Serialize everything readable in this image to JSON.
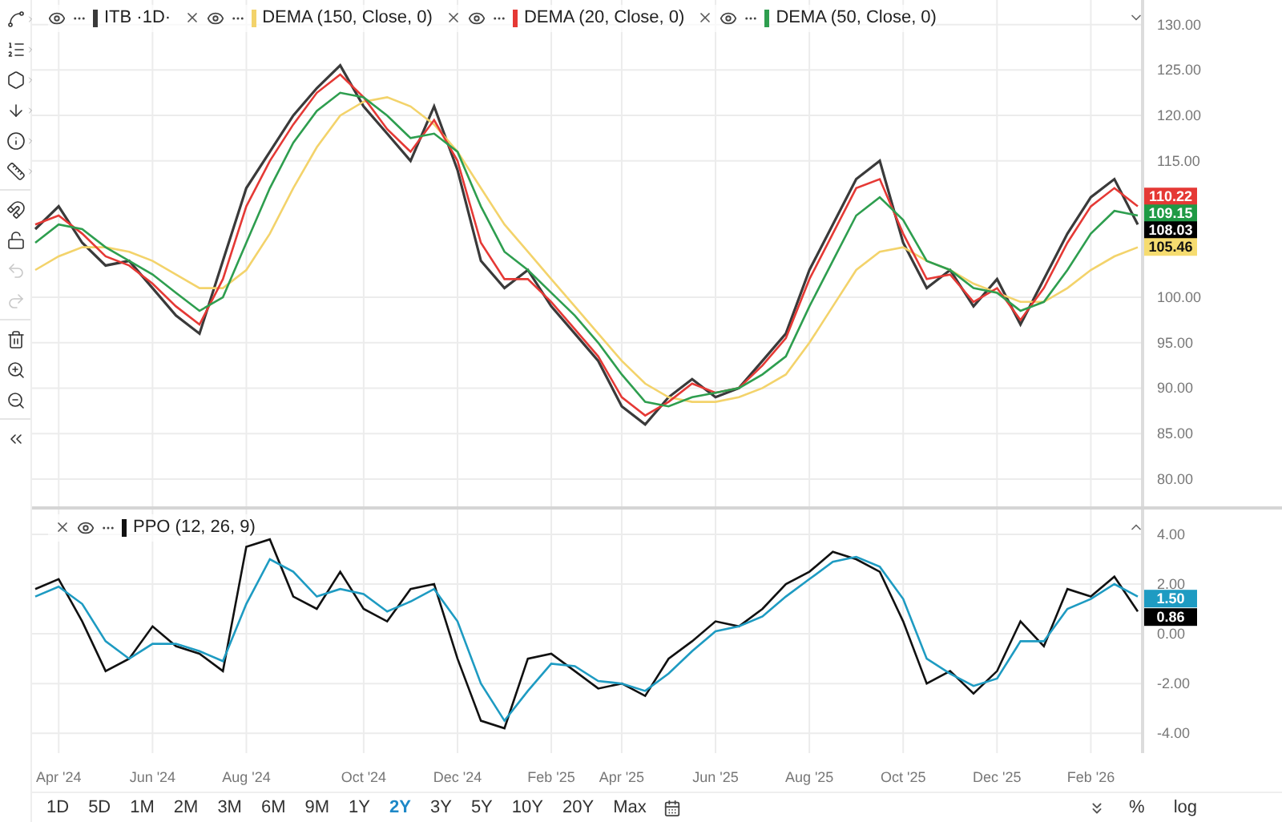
{
  "toolbar": [
    {
      "kind": "trendline",
      "submenu": true,
      "disabled": false
    },
    {
      "kind": "list",
      "submenu": true,
      "disabled": false
    },
    {
      "kind": "shape",
      "submenu": true,
      "disabled": false
    },
    {
      "kind": "arrow",
      "submenu": true,
      "disabled": false
    },
    {
      "kind": "info",
      "submenu": true,
      "disabled": false
    },
    {
      "kind": "measure",
      "submenu": true,
      "disabled": false
    },
    {
      "kind": "magnet",
      "submenu": false,
      "disabled": false
    },
    {
      "kind": "lock",
      "submenu": false,
      "disabled": false
    },
    {
      "kind": "undo",
      "submenu": false,
      "disabled": true
    },
    {
      "kind": "redo",
      "submenu": false,
      "disabled": true
    },
    {
      "kind": "trash",
      "submenu": false,
      "disabled": false
    },
    {
      "kind": "zoom_in",
      "submenu": false,
      "disabled": false
    },
    {
      "kind": "zoom_out",
      "submenu": false,
      "disabled": false
    },
    {
      "kind": "collapse",
      "submenu": false,
      "disabled": false
    }
  ],
  "price_pane": {
    "legend": [
      {
        "closable": false
      },
      {
        "closable": true
      },
      {
        "closable": true
      },
      {
        "closable": true
      }
    ],
    "last_values": [
      {
        "value": "110.22",
        "color": "#e53935"
      },
      {
        "value": "109.15",
        "color": "#1f9a45"
      },
      {
        "value": "108.03",
        "color": "#000000"
      },
      {
        "value": "105.46",
        "color": "#f6dc70"
      }
    ],
    "chart_data": {
      "type": "line",
      "grid": true,
      "ylim": [
        77,
        132.7
      ],
      "categories": [
        null,
        null,
        null,
        null,
        null,
        null,
        null,
        null,
        null,
        null,
        null,
        null,
        null,
        null,
        null,
        null,
        null,
        null,
        null,
        null,
        null,
        null,
        null,
        null,
        null,
        null,
        null,
        null,
        null,
        null,
        null,
        null,
        null,
        null,
        null,
        null,
        null,
        null,
        null,
        null,
        null,
        null,
        null,
        null,
        null,
        null,
        null,
        null
      ],
      "yticks": [
        {
          "value": 130,
          "label": "130.00"
        },
        {
          "value": 125,
          "label": "125.00"
        },
        {
          "value": 120,
          "label": "120.00"
        },
        {
          "value": 115,
          "label": "115.00"
        },
        {
          "value": 100,
          "label": "100.00"
        },
        {
          "value": 95,
          "label": "95.00"
        },
        {
          "value": 90,
          "label": "90.00"
        },
        {
          "value": 85,
          "label": "85.00"
        },
        {
          "value": 80,
          "label": "80.00"
        }
      ],
      "series": [
        {
          "name": "ITB ·1D·",
          "color": "#3a3a3a",
          "values": [
            107.5,
            110,
            106,
            103.5,
            104,
            101,
            98,
            96,
            104,
            112,
            116,
            120,
            123,
            125.5,
            121,
            118,
            115,
            121,
            114,
            104,
            101,
            103,
            99,
            96,
            93,
            88,
            86,
            89,
            91,
            89,
            90,
            93,
            96,
            103,
            108,
            113,
            115,
            106,
            101,
            103,
            99,
            102,
            97,
            102,
            107,
            111,
            113,
            108
          ]
        },
        {
          "name": "DEMA (150, Close, 0)",
          "color": "#f3d36b",
          "values": [
            103,
            104.5,
            105.5,
            105.5,
            105,
            104,
            102.5,
            101,
            101,
            103,
            107,
            112,
            116.5,
            120,
            121.5,
            122,
            121,
            119,
            116,
            112,
            108,
            105,
            102,
            99,
            96,
            93,
            90.5,
            89,
            88.5,
            88.5,
            89,
            90,
            91.5,
            95,
            99,
            103,
            105,
            105.5,
            104,
            103,
            101.5,
            100.5,
            99.5,
            99.5,
            101,
            103,
            104.5,
            105.5
          ]
        },
        {
          "name": "DEMA (20, Close, 0)",
          "color": "#e53935",
          "values": [
            108,
            109,
            107,
            104.5,
            103.5,
            101.5,
            99,
            97,
            102,
            110,
            115,
            119,
            122.5,
            124.5,
            122,
            118.5,
            116,
            119.5,
            115,
            106,
            102,
            102,
            99.5,
            96.5,
            93.5,
            89,
            87,
            88.5,
            90.5,
            89.5,
            90,
            92.5,
            95.5,
            102,
            107,
            112,
            113,
            107,
            102,
            102.5,
            99.5,
            101,
            97.5,
            101,
            106,
            110,
            112,
            110
          ]
        },
        {
          "name": "DEMA (50, Close, 0)",
          "color": "#2e9e4f",
          "values": [
            106,
            108,
            107.5,
            105.5,
            104,
            102.5,
            100.5,
            98.5,
            100,
            106,
            112,
            117,
            120.5,
            122.5,
            122,
            120,
            117.5,
            118,
            116,
            110,
            105,
            103,
            100.5,
            98,
            95,
            91.5,
            88.5,
            88,
            89,
            89.5,
            90,
            91.5,
            93.5,
            99,
            104,
            109,
            111,
            108.5,
            104,
            103,
            101,
            100.5,
            98.5,
            99.5,
            103,
            107,
            109.5,
            109
          ]
        }
      ]
    }
  },
  "ppo_pane": {
    "legend": [
      {
        "closable": true
      }
    ],
    "last_values": [
      {
        "value": "1.50",
        "color": "#1e9bc2"
      },
      {
        "value": "0.86",
        "color": "#000000"
      }
    ],
    "chart_data": {
      "type": "line",
      "grid": true,
      "ylim": [
        -4.8,
        5
      ],
      "categories": [
        null,
        "Apr '24",
        null,
        null,
        null,
        "Jun '24",
        null,
        null,
        null,
        "Aug '24",
        null,
        null,
        null,
        null,
        "Oct '24",
        null,
        null,
        null,
        "Dec '24",
        null,
        null,
        null,
        "Feb '25",
        null,
        null,
        "Apr '25",
        null,
        null,
        null,
        "Jun '25",
        null,
        null,
        null,
        "Aug '25",
        null,
        null,
        null,
        "Oct '25",
        null,
        null,
        null,
        "Dec '25",
        null,
        null,
        null,
        "Feb '26",
        null,
        null
      ],
      "yticks": [
        {
          "value": 4,
          "label": "4.00"
        },
        {
          "value": 2,
          "label": "2.00"
        },
        {
          "value": 0,
          "label": "0.00"
        },
        {
          "value": -2,
          "label": "-2.00"
        },
        {
          "value": -4,
          "label": "-4.00"
        }
      ],
      "series": [
        {
          "name": "PPO (12, 26, 9)",
          "color": "#111111",
          "values": [
            1.8,
            2.2,
            0.5,
            -1.5,
            -1.0,
            0.3,
            -0.5,
            -0.8,
            -1.5,
            3.5,
            3.8,
            1.5,
            1.0,
            2.5,
            1.0,
            0.5,
            1.8,
            2.0,
            -1.0,
            -3.5,
            -3.8,
            -1.0,
            -0.8,
            -1.5,
            -2.2,
            -2.0,
            -2.5,
            -1.0,
            -0.3,
            0.5,
            0.3,
            1.0,
            2.0,
            2.5,
            3.3,
            3.0,
            2.5,
            0.5,
            -2.0,
            -1.5,
            -2.4,
            -1.5,
            0.5,
            -0.5,
            1.8,
            1.5,
            2.3,
            0.9
          ]
        },
        {
          "color": "#1e9bc2",
          "values": [
            1.5,
            1.9,
            1.2,
            -0.3,
            -1.0,
            -0.4,
            -0.4,
            -0.7,
            -1.1,
            1.2,
            3.0,
            2.5,
            1.5,
            1.8,
            1.6,
            0.9,
            1.3,
            1.8,
            0.5,
            -2.0,
            -3.5,
            -2.3,
            -1.2,
            -1.3,
            -1.9,
            -2.0,
            -2.3,
            -1.6,
            -0.7,
            0.1,
            0.3,
            0.7,
            1.5,
            2.2,
            2.9,
            3.1,
            2.7,
            1.4,
            -1.0,
            -1.6,
            -2.1,
            -1.8,
            -0.3,
            -0.3,
            1.0,
            1.4,
            2.0,
            1.5
          ]
        }
      ]
    }
  },
  "ranges": [
    {
      "label": "1D",
      "selected": false
    },
    {
      "label": "5D",
      "selected": false
    },
    {
      "label": "1M",
      "selected": false
    },
    {
      "label": "2M",
      "selected": false
    },
    {
      "label": "3M",
      "selected": false
    },
    {
      "label": "6M",
      "selected": false
    },
    {
      "label": "9M",
      "selected": false
    },
    {
      "label": "1Y",
      "selected": false
    },
    {
      "label": "2Y",
      "selected": true
    },
    {
      "label": "3Y",
      "selected": false
    },
    {
      "label": "5Y",
      "selected": false
    },
    {
      "label": "10Y",
      "selected": false
    },
    {
      "label": "20Y",
      "selected": false
    },
    {
      "label": "Max",
      "selected": false
    }
  ],
  "scale_buttons": [
    "%",
    "log"
  ]
}
